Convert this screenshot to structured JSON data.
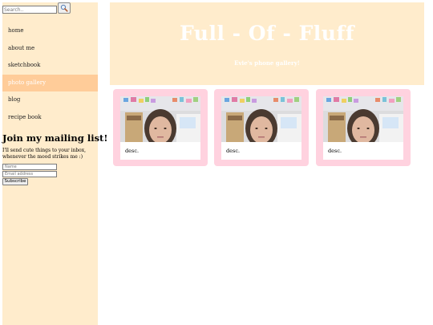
{
  "search": {
    "placeholder": "Search..",
    "button_icon": "search-icon"
  },
  "nav": {
    "items": [
      {
        "label": "home",
        "active": false
      },
      {
        "label": "about me",
        "active": false
      },
      {
        "label": "sketchbook",
        "active": false
      },
      {
        "label": "photo gallery",
        "active": true
      },
      {
        "label": "blog",
        "active": false
      },
      {
        "label": "recipe book",
        "active": false
      }
    ]
  },
  "mailing": {
    "title": "Join my mailing list!",
    "text": "I'll send cute things to your inbox, whenever the mood strikes me :)",
    "name_placeholder": "Name",
    "email_placeholder": "Email address",
    "subscribe_label": "Subscribe"
  },
  "header": {
    "title": "Full - Of - Fluff",
    "subtitle": "Evie's phone gallery!"
  },
  "gallery": {
    "cards": [
      {
        "caption": "desc."
      },
      {
        "caption": "desc."
      },
      {
        "caption": "desc."
      }
    ]
  },
  "colors": {
    "sidebar_bg": "#ffeccc",
    "nav_active_bg": "#ffcc99",
    "header_bg": "#ffeccc",
    "card_bg": "#ffd2df",
    "title_text": "#ffffff"
  }
}
